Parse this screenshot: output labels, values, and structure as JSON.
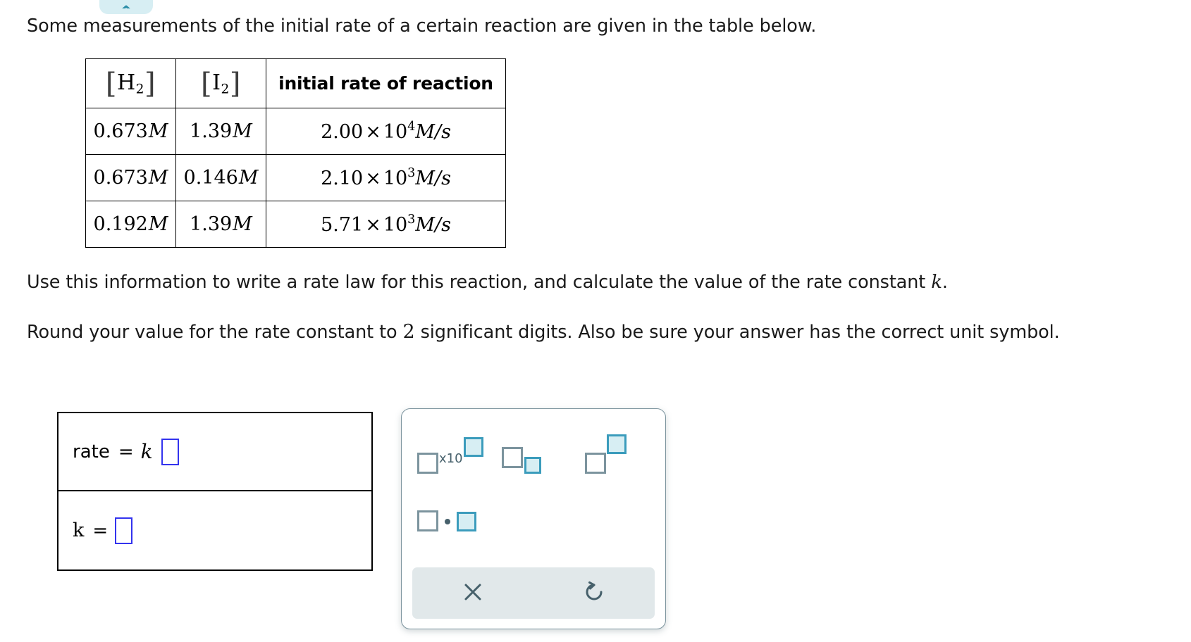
{
  "top_control": {
    "icon": "chevron-up-icon",
    "color": "#d7eef3"
  },
  "prompt": {
    "intro": "Some measurements of the initial rate of a certain reaction are given in the table below.",
    "use_prefix": "Use this information to write a rate law for this reaction, and calculate the value of the rate constant ",
    "use_var": "k",
    "use_suffix": ".",
    "round_prefix": "Round your value for the rate constant to ",
    "round_digits": "2",
    "round_suffix": " significant digits. Also be sure your answer has the correct unit symbol."
  },
  "table": {
    "headers": [
      {
        "species": "H",
        "sub": "2",
        "bracketed": true
      },
      {
        "species": "I",
        "sub": "2",
        "bracketed": true
      },
      {
        "label": "initial rate of reaction",
        "bracketed": false
      }
    ],
    "rows": [
      {
        "h2": "0.673",
        "h2_unit": "M",
        "i2": "1.39",
        "i2_unit": "M",
        "rate_mantissa": "2.00",
        "rate_times": "×",
        "rate_base": "10",
        "rate_exp": "4",
        "rate_unit": "M/s"
      },
      {
        "h2": "0.673",
        "h2_unit": "M",
        "i2": "0.146",
        "i2_unit": "M",
        "rate_mantissa": "2.10",
        "rate_times": "×",
        "rate_base": "10",
        "rate_exp": "3",
        "rate_unit": "M/s"
      },
      {
        "h2": "0.192",
        "h2_unit": "M",
        "i2": "1.39",
        "i2_unit": "M",
        "rate_mantissa": "5.71",
        "rate_times": "×",
        "rate_base": "10",
        "rate_exp": "3",
        "rate_unit": "M/s"
      }
    ]
  },
  "answer_box": {
    "row1": {
      "label": "rate",
      "equals": "=",
      "coefficient": "k",
      "value": ""
    },
    "row2": {
      "label": "k",
      "equals": "=",
      "value": ""
    }
  },
  "math_palette": {
    "buttons": [
      {
        "name": "scientific-notation",
        "x10_text": "x10"
      },
      {
        "name": "subscript"
      },
      {
        "name": "superscript"
      },
      {
        "name": "multiplication-dot"
      }
    ],
    "toolbar": [
      {
        "name": "clear-button",
        "icon": "close-x-icon"
      },
      {
        "name": "undo-button",
        "icon": "undo-arrow-icon"
      }
    ],
    "colors": {
      "empty_slot_border": "#7c949e",
      "filled_slot_border": "#3b9cbc",
      "filled_slot_fill": "#d7eef3",
      "toolbar_bg": "#e1e8ea",
      "panel_border": "#7c949e"
    }
  }
}
